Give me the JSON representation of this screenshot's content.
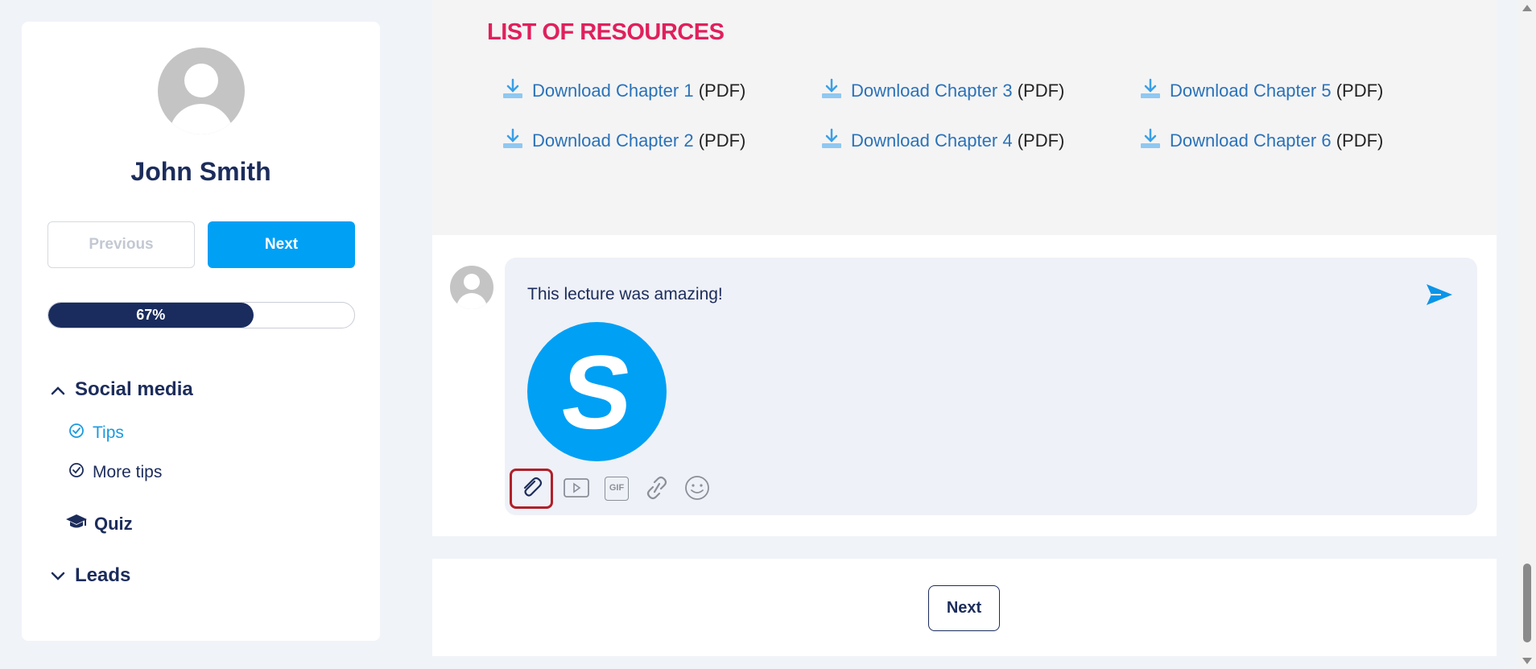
{
  "sidebar": {
    "user_name": "John Smith",
    "prev_label": "Previous",
    "next_label": "Next",
    "progress": {
      "percent": 67,
      "label": "67%"
    },
    "sections": [
      {
        "label": "Social media",
        "expanded": true
      },
      {
        "label": "Leads",
        "expanded": false
      }
    ],
    "items": [
      {
        "label": "Tips",
        "active": true
      },
      {
        "label": "More tips",
        "active": false
      }
    ],
    "quiz_label": "Quiz"
  },
  "resources": {
    "title": "LIST OF RESOURCES",
    "downloads": [
      {
        "link": "Download Chapter 1",
        "ext": "(PDF)"
      },
      {
        "link": "Download Chapter 2",
        "ext": "(PDF)"
      },
      {
        "link": "Download Chapter 3",
        "ext": "(PDF)"
      },
      {
        "link": "Download Chapter 4",
        "ext": "(PDF)"
      },
      {
        "link": "Download Chapter 5",
        "ext": "(PDF)"
      },
      {
        "link": "Download Chapter 6",
        "ext": "(PDF)"
      }
    ]
  },
  "comment": {
    "text": "This lecture was amazing!",
    "image_letter": "S",
    "toolbar": [
      "paperclip-icon",
      "video-icon",
      "gif-icon",
      "link-icon",
      "emoji-icon"
    ],
    "gif_label": "GIF"
  },
  "footer": {
    "next_label": "Next"
  },
  "colors": {
    "accent": "#00a0f5",
    "navy": "#1c2c5b",
    "title_pink": "#e0205c",
    "highlight": "#b0202a"
  }
}
